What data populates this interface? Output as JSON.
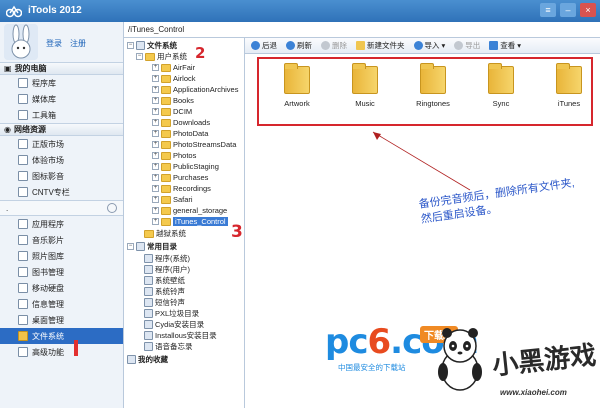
{
  "app": {
    "title": "iTools 2012"
  },
  "account": {
    "login": "登录",
    "register": "注册"
  },
  "sidebar": {
    "my_computer": {
      "title": "我的电脑",
      "items": [
        {
          "label": "程序库"
        },
        {
          "label": "媒体库"
        },
        {
          "label": "工具箱"
        }
      ]
    },
    "network": {
      "title": "网络资源",
      "items": [
        {
          "label": "正版市场"
        },
        {
          "label": "体验市场"
        },
        {
          "label": "图标影音"
        },
        {
          "label": "CNTV专栏"
        }
      ]
    },
    "device": {
      "title": ".",
      "items": [
        {
          "label": "应用程序"
        },
        {
          "label": "音乐影片"
        },
        {
          "label": "照片图库"
        },
        {
          "label": "图书管理"
        },
        {
          "label": "移动硬盘"
        },
        {
          "label": "信息管理"
        },
        {
          "label": "桌面管理"
        },
        {
          "label": "文件系统"
        },
        {
          "label": "高级功能"
        }
      ]
    }
  },
  "path": {
    "value": "/iTunes_Control"
  },
  "tree": {
    "filesystem": "文件系统",
    "user_system": "用户系统",
    "folders": [
      "AirFair",
      "Airlock",
      "ApplicationArchives",
      "Books",
      "DCIM",
      "Downloads",
      "PhotoData",
      "PhotoStreamsData",
      "Photos",
      "PublicStaging",
      "Purchases",
      "Recordings",
      "Safari",
      "general_storage",
      "iTunes_Control"
    ],
    "jailbreak": "越狱系统",
    "common_dirs": "常用目录",
    "common_items": [
      "程序(系统)",
      "程序(用户)",
      "系统壁纸",
      "系统铃声",
      "短信铃声",
      "PXL垃圾目录",
      "Cydia安装目录",
      "Installous安装目录",
      "语音备忘录"
    ],
    "favorites": "我的收藏"
  },
  "toolbar": {
    "back": "后退",
    "refresh": "刷新",
    "delete": "删除",
    "new_folder": "新建文件夹",
    "import": "导入",
    "export": "导出",
    "view": "查看"
  },
  "content": {
    "folders": [
      "Artwork",
      "Music",
      "Ringtones",
      "Sync",
      "iTunes"
    ]
  },
  "annotations": {
    "note_line1": "备份完音频后，删除所有文件夹,",
    "note_line2": "然后重启设备。",
    "num2": "2",
    "num3": "3"
  },
  "watermark": {
    "pc": "pc",
    "six": "6",
    "com": ".com",
    "badge": "下载站",
    "sub": "中国最安全的下载站",
    "xiaohei": "小黑游戏",
    "url": "www.xiaohei.com"
  },
  "colors": {
    "title_bar": "#2f72b8",
    "selection": "#2c6cc4",
    "annotation_red": "#d6262d",
    "annotation_blue": "#2b57c9",
    "folder": "#f4c94d"
  }
}
